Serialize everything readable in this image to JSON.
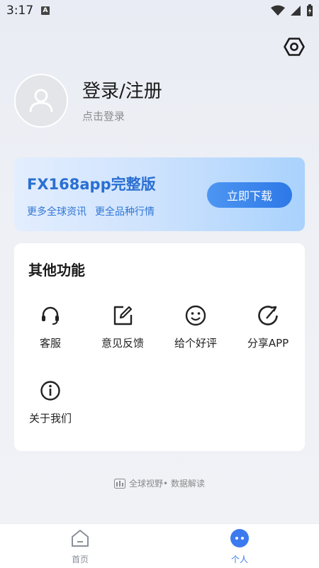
{
  "status": {
    "time": "3:17",
    "indicator": "A"
  },
  "header": {
    "settings_icon": "settings-hex-icon"
  },
  "profile": {
    "title": "登录/注册",
    "subtitle": "点击登录"
  },
  "promo": {
    "title": "FX168app完整版",
    "subtitle_1": "更多全球资讯",
    "subtitle_2": "更全品种行情",
    "button": "立即下载"
  },
  "features": {
    "title": "其他功能",
    "items": [
      {
        "label": "客服",
        "icon": "headset-icon"
      },
      {
        "label": "意见反馈",
        "icon": "edit-icon"
      },
      {
        "label": "给个好评",
        "icon": "smile-icon"
      },
      {
        "label": "分享APP",
        "icon": "share-icon"
      },
      {
        "label": "关于我们",
        "icon": "info-icon"
      }
    ]
  },
  "footer": {
    "slogan": "全球视野• 数据解读"
  },
  "nav": {
    "home": "首页",
    "profile": "个人",
    "colors": {
      "active": "#3b7bef",
      "inactive": "#8a8f99"
    }
  }
}
